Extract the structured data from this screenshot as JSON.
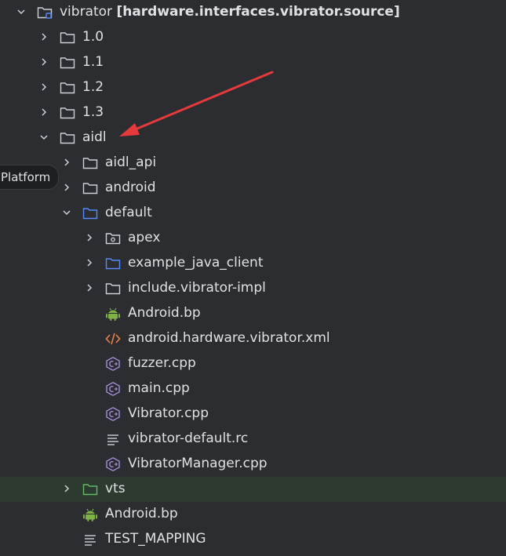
{
  "project_root": {
    "name": "vibrator",
    "module": "[hardware.interfaces.vibrator.source]"
  },
  "tooltip": "Platform",
  "items": [
    {
      "label": "1.0"
    },
    {
      "label": "1.1"
    },
    {
      "label": "1.2"
    },
    {
      "label": "1.3"
    },
    {
      "label": "aidl"
    },
    {
      "label": "aidl_api"
    },
    {
      "label": "android"
    },
    {
      "label": "default"
    },
    {
      "label": "apex"
    },
    {
      "label": "example_java_client"
    },
    {
      "label": "include.vibrator-impl"
    },
    {
      "label": "Android.bp"
    },
    {
      "label": "android.hardware.vibrator.xml"
    },
    {
      "label": "fuzzer.cpp"
    },
    {
      "label": "main.cpp"
    },
    {
      "label": "Vibrator.cpp"
    },
    {
      "label": "vibrator-default.rc"
    },
    {
      "label": "VibratorManager.cpp"
    },
    {
      "label": "vts"
    },
    {
      "label": "Android.bp"
    },
    {
      "label": "TEST_MAPPING"
    }
  ],
  "colors": {
    "background": "#2b2d30",
    "text": "#dfe1e5",
    "folder_default": "#ced0d6",
    "folder_source": "#548af7",
    "folder_test": "#5fb865",
    "android_green": "#7fb347",
    "xml_orange": "#e8804a",
    "cpp_purple": "#a78bd8",
    "arrow_red": "#e5393b",
    "highlight_row": "#2d3a2f"
  }
}
